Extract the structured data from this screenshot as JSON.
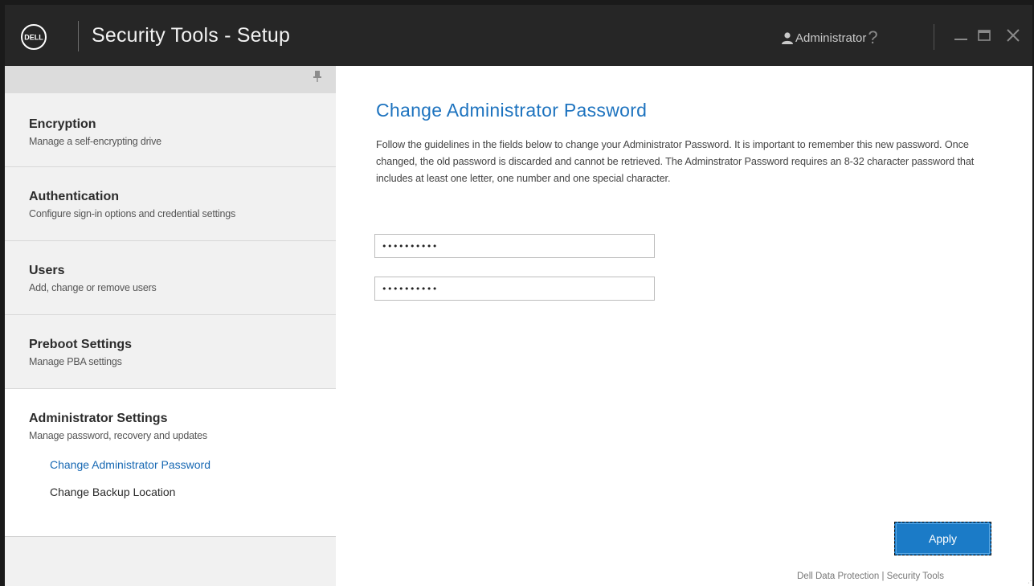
{
  "titlebar": {
    "logo_text": "DELL",
    "app_title": "Security Tools - Setup",
    "user_name": "Administrator",
    "help_label": "?"
  },
  "sidebar": {
    "items": [
      {
        "title": "Encryption",
        "description": "Manage a self-encrypting drive"
      },
      {
        "title": "Authentication",
        "description": "Configure sign-in options and credential settings"
      },
      {
        "title": "Users",
        "description": "Add, change or remove users"
      },
      {
        "title": "Preboot Settings",
        "description": "Manage PBA settings"
      },
      {
        "title": "Administrator Settings",
        "description": "Manage password, recovery and updates",
        "subitems": [
          "Change Administrator Password",
          "Change Backup Location"
        ]
      }
    ]
  },
  "main": {
    "title": "Change Administrator Password",
    "description": "Follow the guidelines in the fields below to change your Administrator Password. It is important to remember this new password. Once changed, the old password is discarded and cannot be retrieved. The Adminstrator Password requires an 8-32 character password that includes at least one letter, one number and one special character.",
    "password_field_1": "••••••••••",
    "password_field_2": "••••••••••",
    "apply_label": "Apply",
    "footer": "Dell Data Protection | Security Tools"
  },
  "icons": {
    "logo": "dell-logo-icon",
    "user": "user-icon",
    "help": "help-icon",
    "minimize": "minimize-icon",
    "maximize": "maximize-icon",
    "close": "close-icon",
    "pin": "pin-icon"
  },
  "colors": {
    "titlebar_bg": "#262626",
    "accent_blue": "#1d73bf",
    "button_blue": "#1b7bc7",
    "sidebar_bg": "#f1f1f1",
    "selected_bg": "#ffffff"
  }
}
